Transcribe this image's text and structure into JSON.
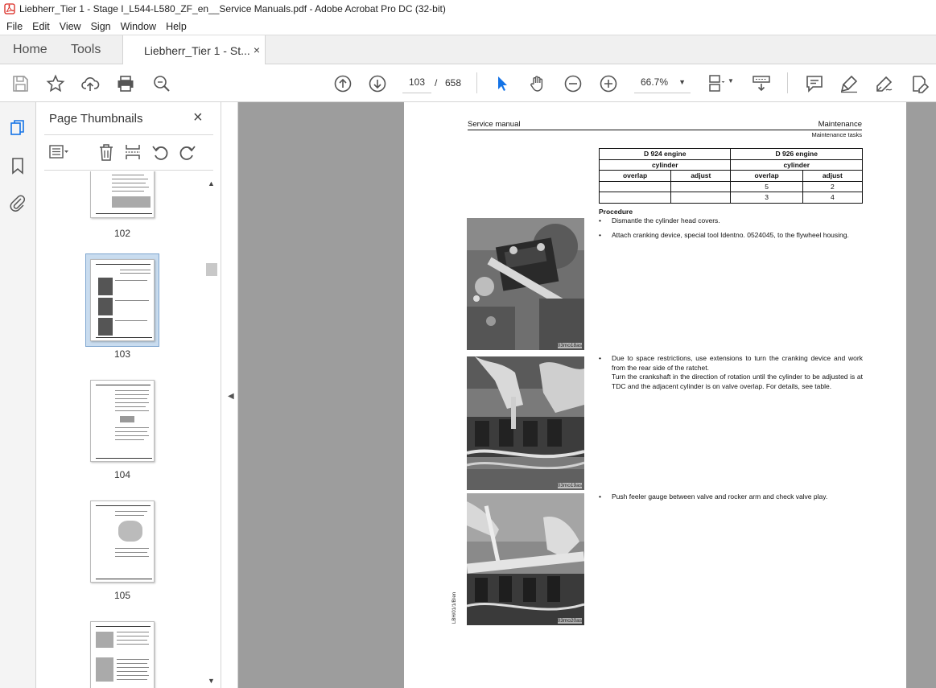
{
  "window": {
    "title": "Liebherr_Tier 1 - Stage I_L544-L580_ZF_en__Service Manuals.pdf - Adobe Acrobat Pro DC (32-bit)"
  },
  "menu": [
    "File",
    "Edit",
    "View",
    "Sign",
    "Window",
    "Help"
  ],
  "tabs": {
    "home": "Home",
    "tools": "Tools",
    "document": "Liebherr_Tier 1 - St...",
    "close_glyph": "×"
  },
  "toolbar": {
    "current_page": "103",
    "page_separator": "/",
    "total_pages": "658",
    "zoom": "66.7%"
  },
  "thumbnails_panel": {
    "title": "Page Thumbnails",
    "close_glyph": "×",
    "pages": [
      {
        "label": "102",
        "selected": false
      },
      {
        "label": "103",
        "selected": true
      },
      {
        "label": "104",
        "selected": false
      },
      {
        "label": "105",
        "selected": false
      }
    ]
  },
  "document": {
    "header_left": "Service manual",
    "header_right": "Maintenance",
    "subheader": "Maintenance tasks",
    "table": {
      "engines": [
        "D 924 engine",
        "D 926 engine"
      ],
      "cylinder_label": "cylinder",
      "col_labels": [
        "overlap",
        "adjust",
        "overlap",
        "adjust"
      ],
      "rows": [
        [
          "",
          "",
          "5",
          "2"
        ],
        [
          "",
          "",
          "3",
          "4"
        ]
      ]
    },
    "procedure_heading": "Procedure",
    "steps": [
      "Dismantle the cylinder head covers.",
      "Attach cranking device, special tool Identno. 0524045, to the flywheel housing.",
      "Due to space restrictions, use extensions to turn the cranking device and work from the rear side of the ratchet.",
      "Turn the crankshaft in the direction of rotation until the cylinder to be adjusted is at TDC and the adjacent cylinder is on valve overlap. For details, see table.",
      "Push feeler gauge between valve and rocker arm and check valve play."
    ],
    "bullet_glyph": "•",
    "photo_captions": [
      "03mo18as",
      "03mo19as",
      "03mo20as"
    ],
    "side_code": "LBH/01/1/B/en"
  },
  "colors": {
    "accent_red": "#d9251d",
    "doc_background": "#9d9d9d",
    "selection_fill": "#c9dcef",
    "select_tool_blue": "#1473e6"
  }
}
